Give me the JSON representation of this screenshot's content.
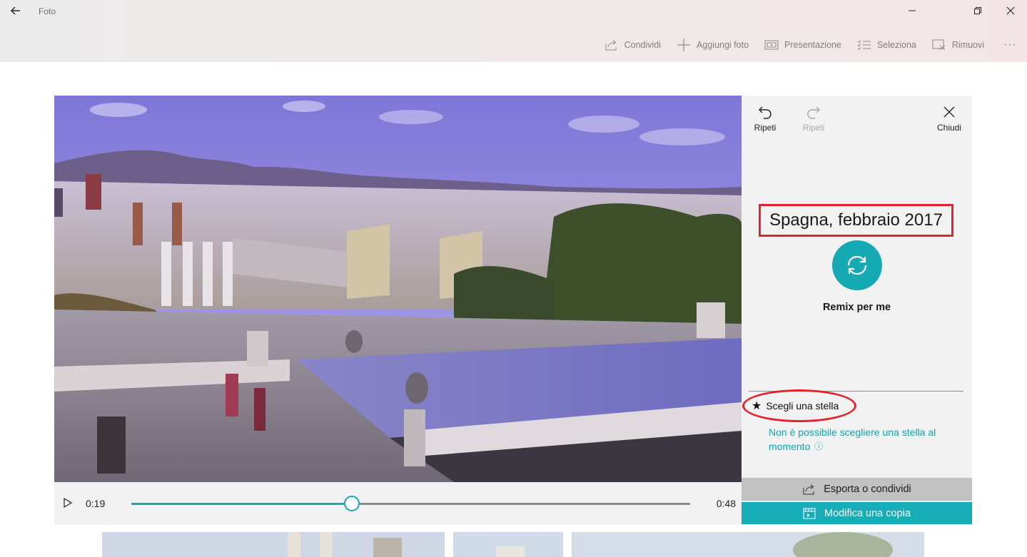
{
  "window": {
    "title": "Foto",
    "icons": {
      "back": "arrow-left-icon",
      "minimize": "minimize-icon",
      "maximize": "restore-icon",
      "close": "close-icon"
    }
  },
  "commands": [
    {
      "id": "share",
      "label": "Condividi",
      "icon": "share-icon"
    },
    {
      "id": "add-photos",
      "label": "Aggiungi foto",
      "icon": "plus-icon"
    },
    {
      "id": "slideshow",
      "label": "Presentazione",
      "icon": "slideshow-icon"
    },
    {
      "id": "select",
      "label": "Seleziona",
      "icon": "checklist-icon"
    },
    {
      "id": "remove",
      "label": "Rimuovi",
      "icon": "remove-icon"
    }
  ],
  "more_label": "···",
  "player": {
    "current_time": "0:19",
    "total_time": "0:48",
    "progress": 0.395,
    "accent_color": "#1ba8b5"
  },
  "side_panel": {
    "undo_label": "Ripeti",
    "redo_label": "Ripeti",
    "close_label": "Chiudi",
    "video_title": "Spagna, febbraio 2017",
    "remix_label": "Remix per me",
    "star_label": "Scegli una stella",
    "star_glyph": "★",
    "star_note": "Non è possibile scegliere una stella al momento",
    "info_glyph": "ⓘ",
    "export_label": "Esporta o condividi",
    "edit_copy_label": "Modifica una copia",
    "highlight_color": "#e3232d",
    "teal_color": "#16aab5"
  }
}
